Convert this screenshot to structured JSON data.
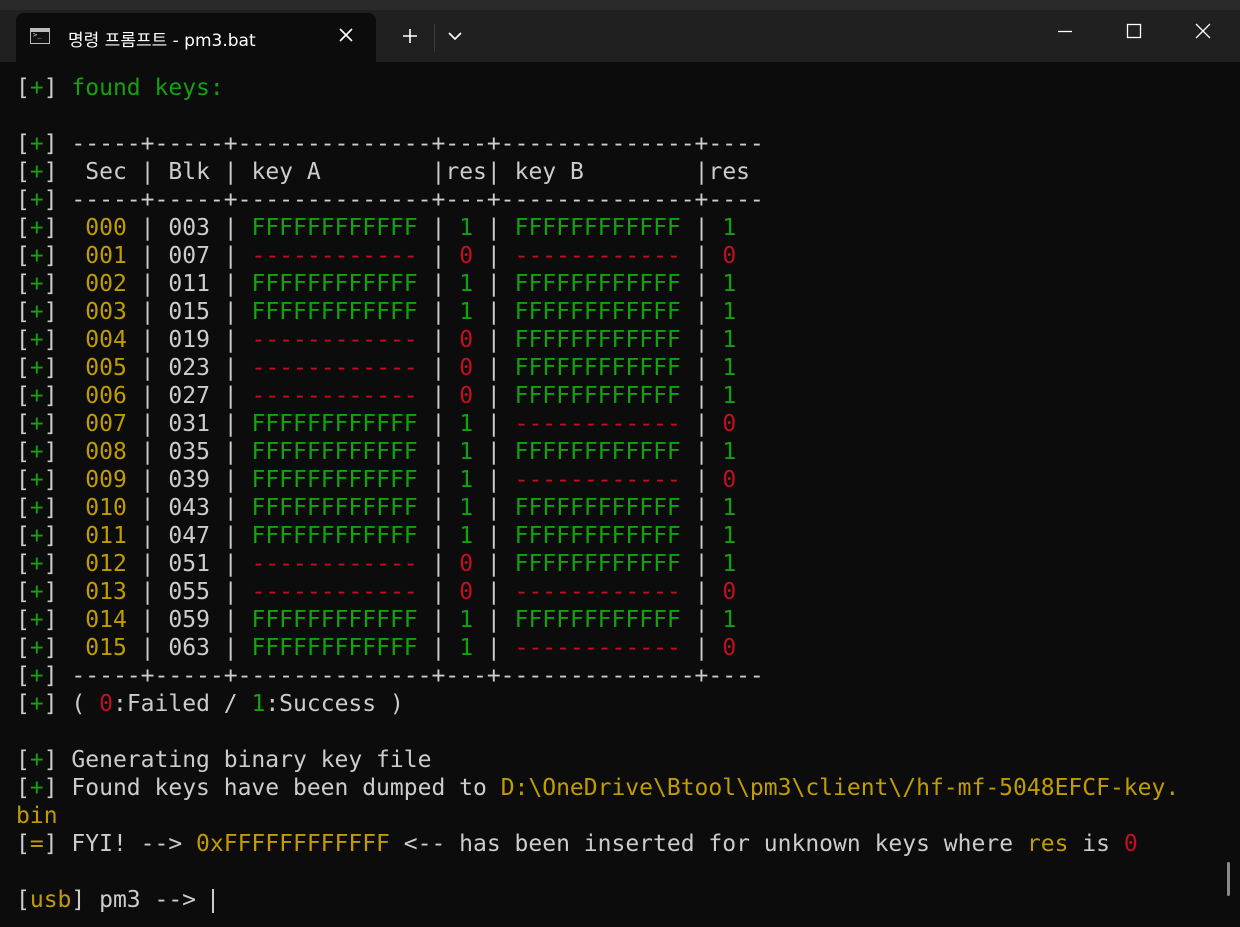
{
  "window": {
    "tab_title": "명령 프롬프트 - pm3.bat"
  },
  "terminal": {
    "prefix_plus": "[+]",
    "prefix_eq": "[=]",
    "found_keys": "found keys:",
    "separator": "-----+-----+--------------+---+--------------+----",
    "header": {
      "sec": "Sec",
      "blk": "Blk",
      "key_a": "key A",
      "res": "res",
      "key_b": "key B"
    },
    "rows": [
      {
        "sec": "000",
        "blk": "003",
        "key_a": "FFFFFFFFFFFF",
        "res_a": "1",
        "key_b": "FFFFFFFFFFFF",
        "res_b": "1"
      },
      {
        "sec": "001",
        "blk": "007",
        "key_a": "------------",
        "res_a": "0",
        "key_b": "------------",
        "res_b": "0"
      },
      {
        "sec": "002",
        "blk": "011",
        "key_a": "FFFFFFFFFFFF",
        "res_a": "1",
        "key_b": "FFFFFFFFFFFF",
        "res_b": "1"
      },
      {
        "sec": "003",
        "blk": "015",
        "key_a": "FFFFFFFFFFFF",
        "res_a": "1",
        "key_b": "FFFFFFFFFFFF",
        "res_b": "1"
      },
      {
        "sec": "004",
        "blk": "019",
        "key_a": "------------",
        "res_a": "0",
        "key_b": "FFFFFFFFFFFF",
        "res_b": "1"
      },
      {
        "sec": "005",
        "blk": "023",
        "key_a": "------------",
        "res_a": "0",
        "key_b": "FFFFFFFFFFFF",
        "res_b": "1"
      },
      {
        "sec": "006",
        "blk": "027",
        "key_a": "------------",
        "res_a": "0",
        "key_b": "FFFFFFFFFFFF",
        "res_b": "1"
      },
      {
        "sec": "007",
        "blk": "031",
        "key_a": "FFFFFFFFFFFF",
        "res_a": "1",
        "key_b": "------------",
        "res_b": "0"
      },
      {
        "sec": "008",
        "blk": "035",
        "key_a": "FFFFFFFFFFFF",
        "res_a": "1",
        "key_b": "FFFFFFFFFFFF",
        "res_b": "1"
      },
      {
        "sec": "009",
        "blk": "039",
        "key_a": "FFFFFFFFFFFF",
        "res_a": "1",
        "key_b": "------------",
        "res_b": "0"
      },
      {
        "sec": "010",
        "blk": "043",
        "key_a": "FFFFFFFFFFFF",
        "res_a": "1",
        "key_b": "FFFFFFFFFFFF",
        "res_b": "1"
      },
      {
        "sec": "011",
        "blk": "047",
        "key_a": "FFFFFFFFFFFF",
        "res_a": "1",
        "key_b": "FFFFFFFFFFFF",
        "res_b": "1"
      },
      {
        "sec": "012",
        "blk": "051",
        "key_a": "------------",
        "res_a": "0",
        "key_b": "FFFFFFFFFFFF",
        "res_b": "1"
      },
      {
        "sec": "013",
        "blk": "055",
        "key_a": "------------",
        "res_a": "0",
        "key_b": "------------",
        "res_b": "0"
      },
      {
        "sec": "014",
        "blk": "059",
        "key_a": "FFFFFFFFFFFF",
        "res_a": "1",
        "key_b": "FFFFFFFFFFFF",
        "res_b": "1"
      },
      {
        "sec": "015",
        "blk": "063",
        "key_a": "FFFFFFFFFFFF",
        "res_a": "1",
        "key_b": "------------",
        "res_b": "0"
      }
    ],
    "legend": {
      "open": "( ",
      "zero": "0",
      "failed": ":Failed / ",
      "one": "1",
      "success": ":Success )"
    },
    "generating": "Generating binary key file",
    "dumped_text": "Found keys have been dumped to ",
    "dump_path_1": "D:\\OneDrive\\Btool\\pm3\\client\\/hf-mf-5048EFCF-key.",
    "dump_path_2": "bin",
    "fyi": {
      "text1": "FYI! --> ",
      "key": "0xFFFFFFFFFFFF",
      "text2": " <-- has been inserted for unknown keys where ",
      "res": "res",
      "text3": " is ",
      "zero": "0"
    },
    "prompt": {
      "usb": "usb",
      "text": "] pm3 --> "
    }
  },
  "colors": {
    "background": "#0c0c0c",
    "titlebar": "#202020",
    "text": "#cccccc",
    "green": "#13a10e",
    "yellow": "#c19c00",
    "red": "#c50f1f"
  },
  "icons": {
    "tab": "terminal-icon",
    "close_tab": "close-icon",
    "new_tab": "plus-icon",
    "dropdown": "chevron-down-icon",
    "minimize": "minimize-icon",
    "maximize": "maximize-icon",
    "close_window": "close-icon"
  }
}
